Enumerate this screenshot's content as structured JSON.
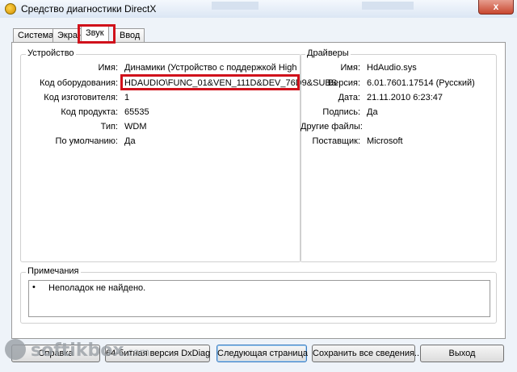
{
  "window": {
    "title": "Средство диагностики DirectX",
    "close_glyph": "x"
  },
  "tabs": [
    {
      "label": "Система"
    },
    {
      "label": "Экран"
    },
    {
      "label": "Звук"
    },
    {
      "label": "Ввод"
    }
  ],
  "device": {
    "title": "Устройство",
    "rows": [
      {
        "label": "Имя:",
        "value": "Динамики (Устройство с поддержкой High"
      },
      {
        "label": "Код оборудования:",
        "value": "HDAUDIO\\FUNC_01&VEN_111D&DEV_76D9&SUBS"
      },
      {
        "label": "Код изготовителя:",
        "value": "1"
      },
      {
        "label": "Код продукта:",
        "value": "65535"
      },
      {
        "label": "Тип:",
        "value": "WDM"
      },
      {
        "label": "По умолчанию:",
        "value": "Да"
      }
    ]
  },
  "drivers": {
    "title": "Драйверы",
    "rows": [
      {
        "label": "Имя:",
        "value": "HdAudio.sys"
      },
      {
        "label": "Версия:",
        "value": "6.01.7601.17514 (Русский)"
      },
      {
        "label": "Дата:",
        "value": "21.11.2010 6:23:47"
      },
      {
        "label": "Подпись:",
        "value": "Да"
      },
      {
        "label": "Другие файлы:",
        "value": ""
      },
      {
        "label": "Поставщик:",
        "value": "Microsoft"
      }
    ]
  },
  "notes": {
    "title": "Примечания",
    "bullet": "•",
    "items": [
      "Неполадок не найдено."
    ]
  },
  "buttons": {
    "help": "Справка",
    "dxdiag64": "64-битная версия DxDiag",
    "next_page": "Следующая страница",
    "save_all": "Сохранить все сведения...",
    "exit": "Выход"
  },
  "watermark": {
    "text": "softikbox",
    "suffix": ".com"
  }
}
